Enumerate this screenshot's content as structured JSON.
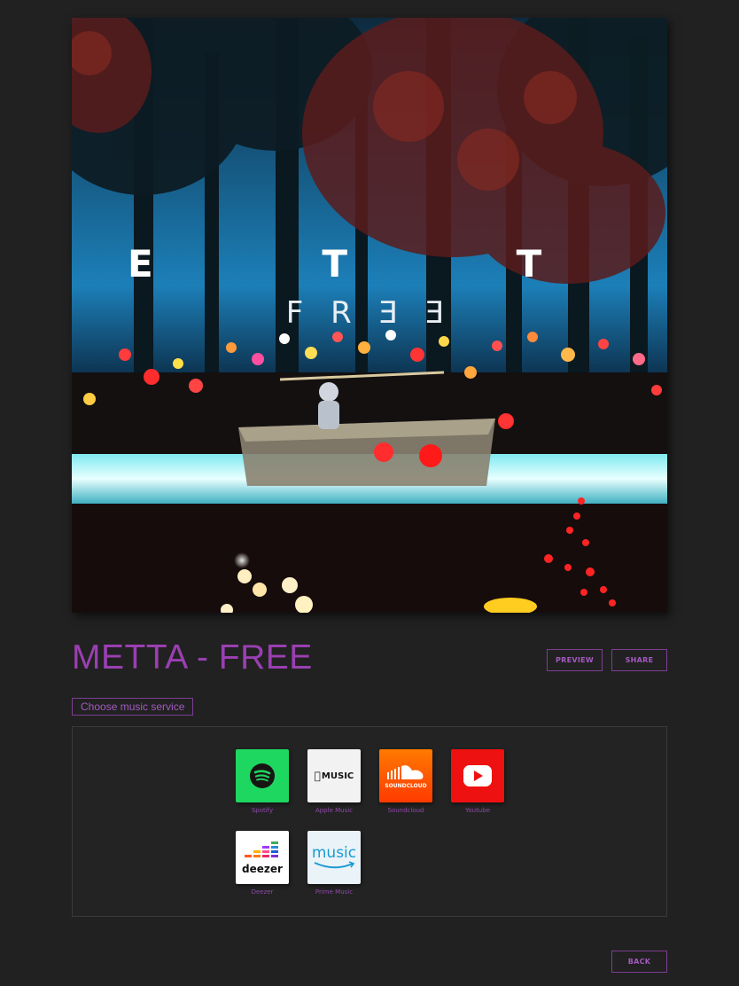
{
  "cover": {
    "artist_text": "M E T T A",
    "title_text": "F R Ǝ Ǝ"
  },
  "track": {
    "title": "METTA - FREE"
  },
  "buttons": {
    "preview": "PREVIEW",
    "share": "SHARE",
    "back": "BACK"
  },
  "choose_label": "Choose music service",
  "services": [
    {
      "name": "Spotify",
      "tile_color": "#1ed760",
      "icon": "spotify-icon"
    },
    {
      "name": "Apple Music",
      "tile_color": "#f2f2f2",
      "icon": "apple-music-icon",
      "tile_text": "MUSIC"
    },
    {
      "name": "Soundcloud",
      "tile_color": "#ff5500",
      "icon": "soundcloud-icon",
      "tile_text": "SOUNDCLOUD"
    },
    {
      "name": "Youtube",
      "tile_color": "#ee1111",
      "icon": "youtube-icon"
    },
    {
      "name": "Deezer",
      "tile_color": "#ffffff",
      "icon": "deezer-icon",
      "tile_text": "deezer"
    },
    {
      "name": "Prime Music",
      "tile_color": "#eaf3f7",
      "icon": "amazon-music-icon",
      "tile_text": "music"
    }
  ],
  "colors": {
    "background": "#212121",
    "accent": "#9a3fb2"
  }
}
